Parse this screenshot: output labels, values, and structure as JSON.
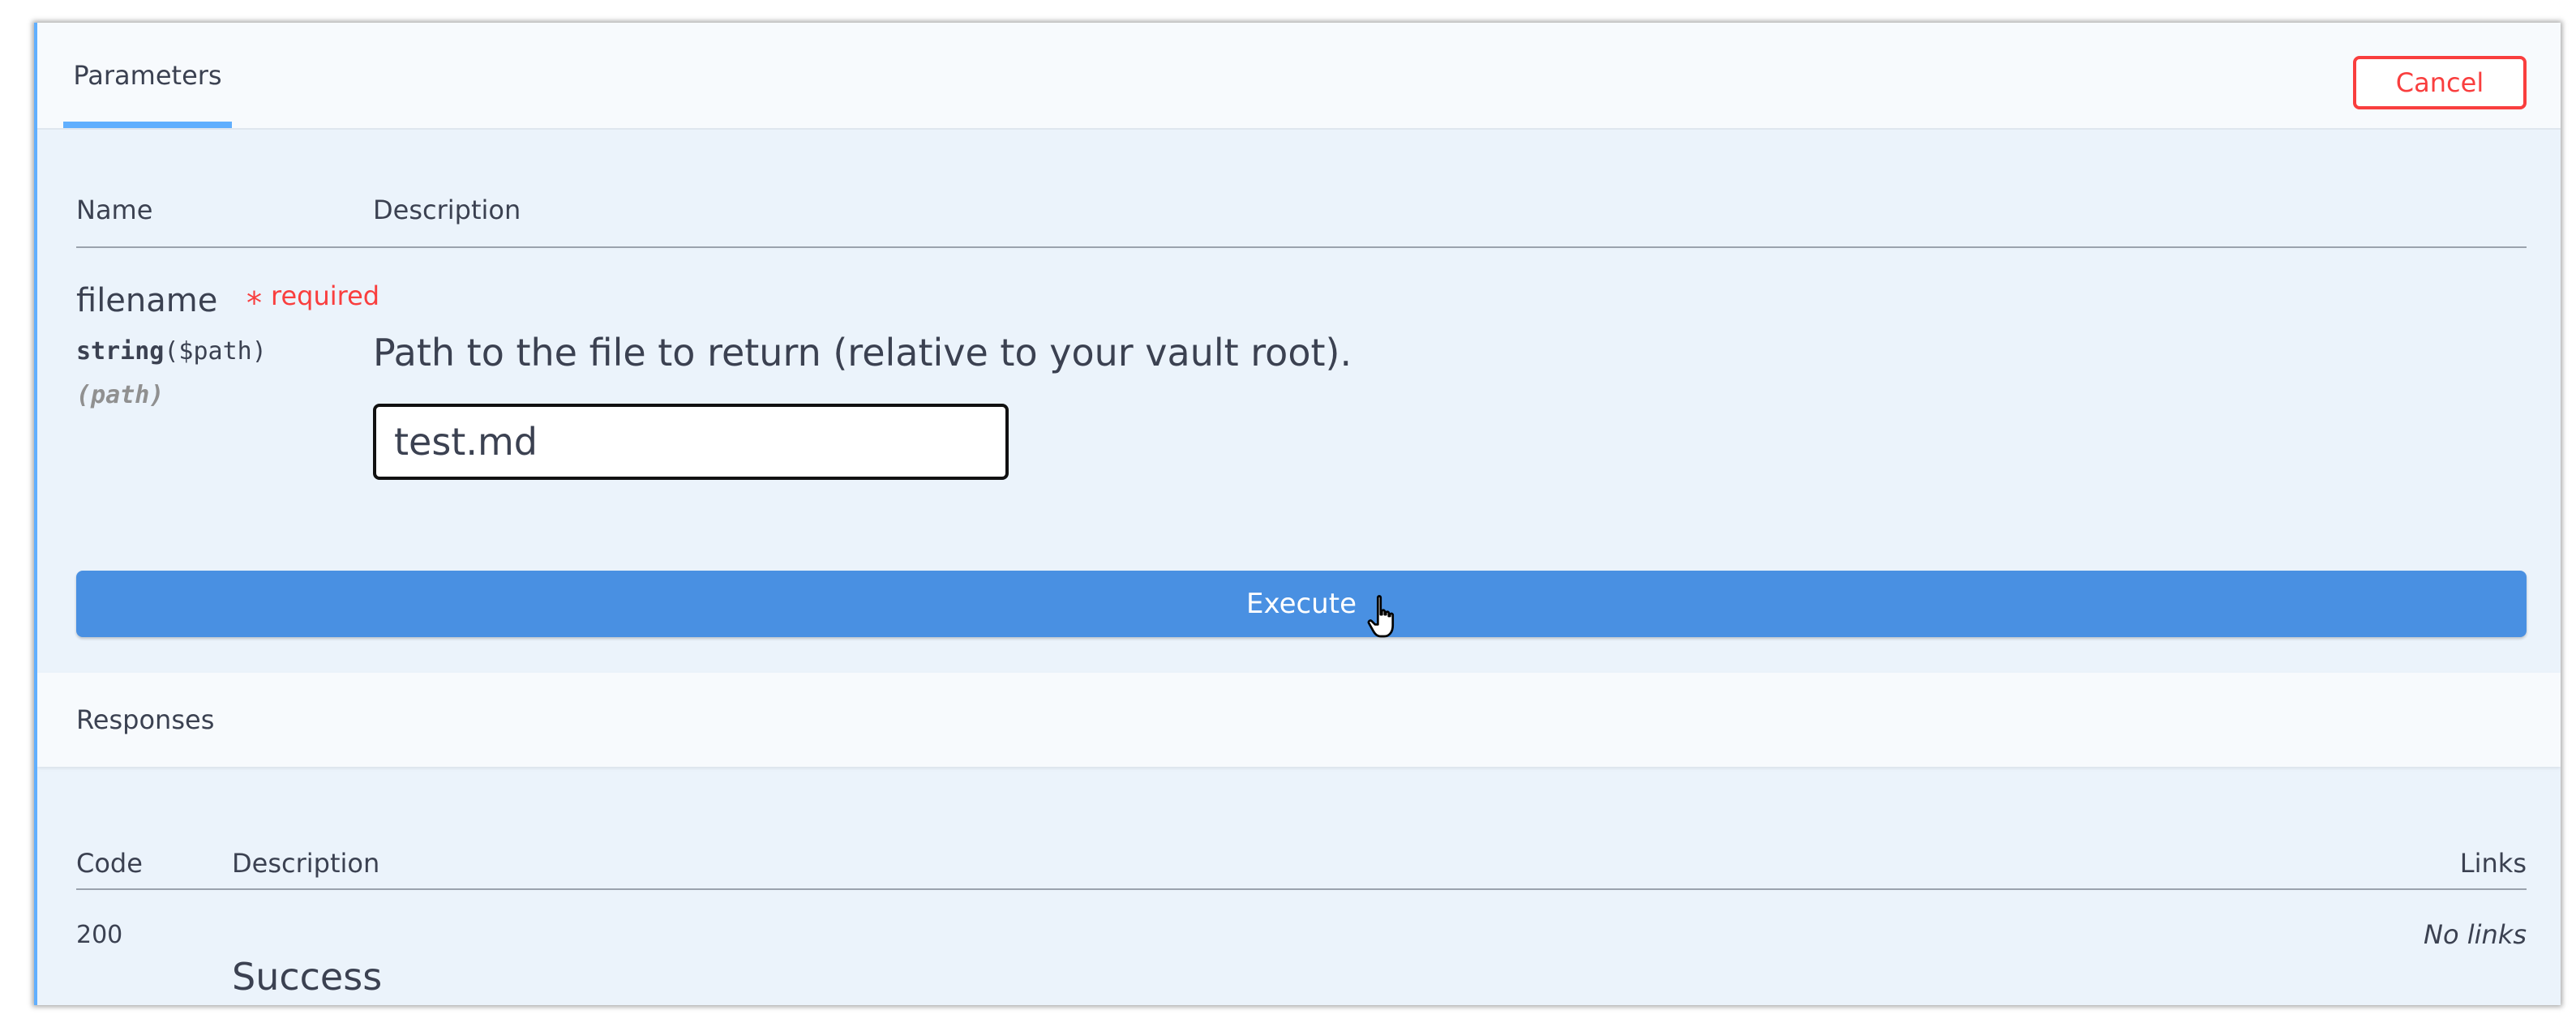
{
  "tabs": {
    "active_label": "Parameters"
  },
  "actions": {
    "cancel_label": "Cancel",
    "execute_label": "Execute"
  },
  "parameters": {
    "headers": {
      "name": "Name",
      "description": "Description"
    },
    "items": [
      {
        "name": "filename",
        "required_mark": "*",
        "required_label": "required",
        "type": "string",
        "format": "($path)",
        "in": "(path)",
        "description": "Path to the file to return (relative to your vault root).",
        "value": "test.md"
      }
    ]
  },
  "responses": {
    "title": "Responses",
    "headers": {
      "code": "Code",
      "description": "Description",
      "links": "Links"
    },
    "items": [
      {
        "code": "200",
        "description": "Success",
        "links": "No links"
      }
    ]
  },
  "colors": {
    "accent": "#61affe",
    "execute": "#4990e2",
    "danger": "#f93e3e",
    "panel_bg": "#ebf3fb"
  },
  "icons": {
    "cursor": "hand-pointer-icon"
  }
}
